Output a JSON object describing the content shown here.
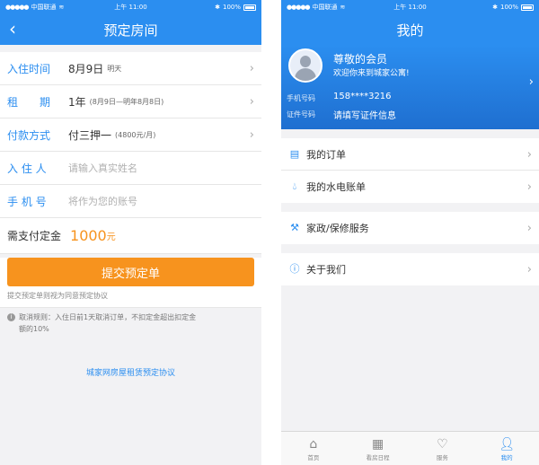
{
  "left": {
    "status": {
      "carrier": "中国联通",
      "time": "上午 11:00",
      "battery": "100%"
    },
    "nav_title": "预定房间",
    "rows": [
      {
        "label": "入住时间",
        "value": "8月9日",
        "sub": "明天"
      },
      {
        "label": "租　　期",
        "value": "1年",
        "sub": "(8月9日—明年8月8日)"
      },
      {
        "label": "付款方式",
        "value": "付三押一",
        "sub": "(4800元/月)"
      },
      {
        "label": "入 住 人",
        "placeholder": "请输入真实姓名"
      },
      {
        "label": "手 机 号",
        "placeholder": "将作为您的账号"
      }
    ],
    "deposit": {
      "label": "需支付定金",
      "amount": "1000",
      "unit": "元"
    },
    "submit_label": "提交预定单",
    "submit_note": "提交预定单则视为同意预定协议",
    "rule_text": "取消规则：入住日前1天取消订单，不扣定金超出扣定金额的10%",
    "agreement_link": "城家网房屋租赁预定协议"
  },
  "right": {
    "status": {
      "carrier": "中国联通",
      "time": "上午 11:00",
      "battery": "100%"
    },
    "nav_title": "我的",
    "profile": {
      "name": "尊敬的会员",
      "welcome": "欢迎你来到城家公寓!",
      "phone_label": "手机号码",
      "phone": "158****3216",
      "id_label": "证件号码",
      "id_value": "请填写证件信息"
    },
    "menu": [
      {
        "label": "我的订单",
        "icon": "order-icon"
      },
      {
        "label": "我的水电账单",
        "icon": "water-drop-icon"
      },
      {
        "label": "家政/保修服务",
        "icon": "broom-icon"
      },
      {
        "label": "关于我们",
        "icon": "info-icon"
      }
    ],
    "tabs": [
      {
        "label": "首页",
        "icon": "home-icon"
      },
      {
        "label": "看房日程",
        "icon": "calendar-icon"
      },
      {
        "label": "服务",
        "icon": "service-icon"
      },
      {
        "label": "我的",
        "icon": "user-icon"
      }
    ],
    "active_tab": "我的"
  },
  "colors": {
    "accent": "#2b8ef0",
    "orange": "#f7931e"
  }
}
